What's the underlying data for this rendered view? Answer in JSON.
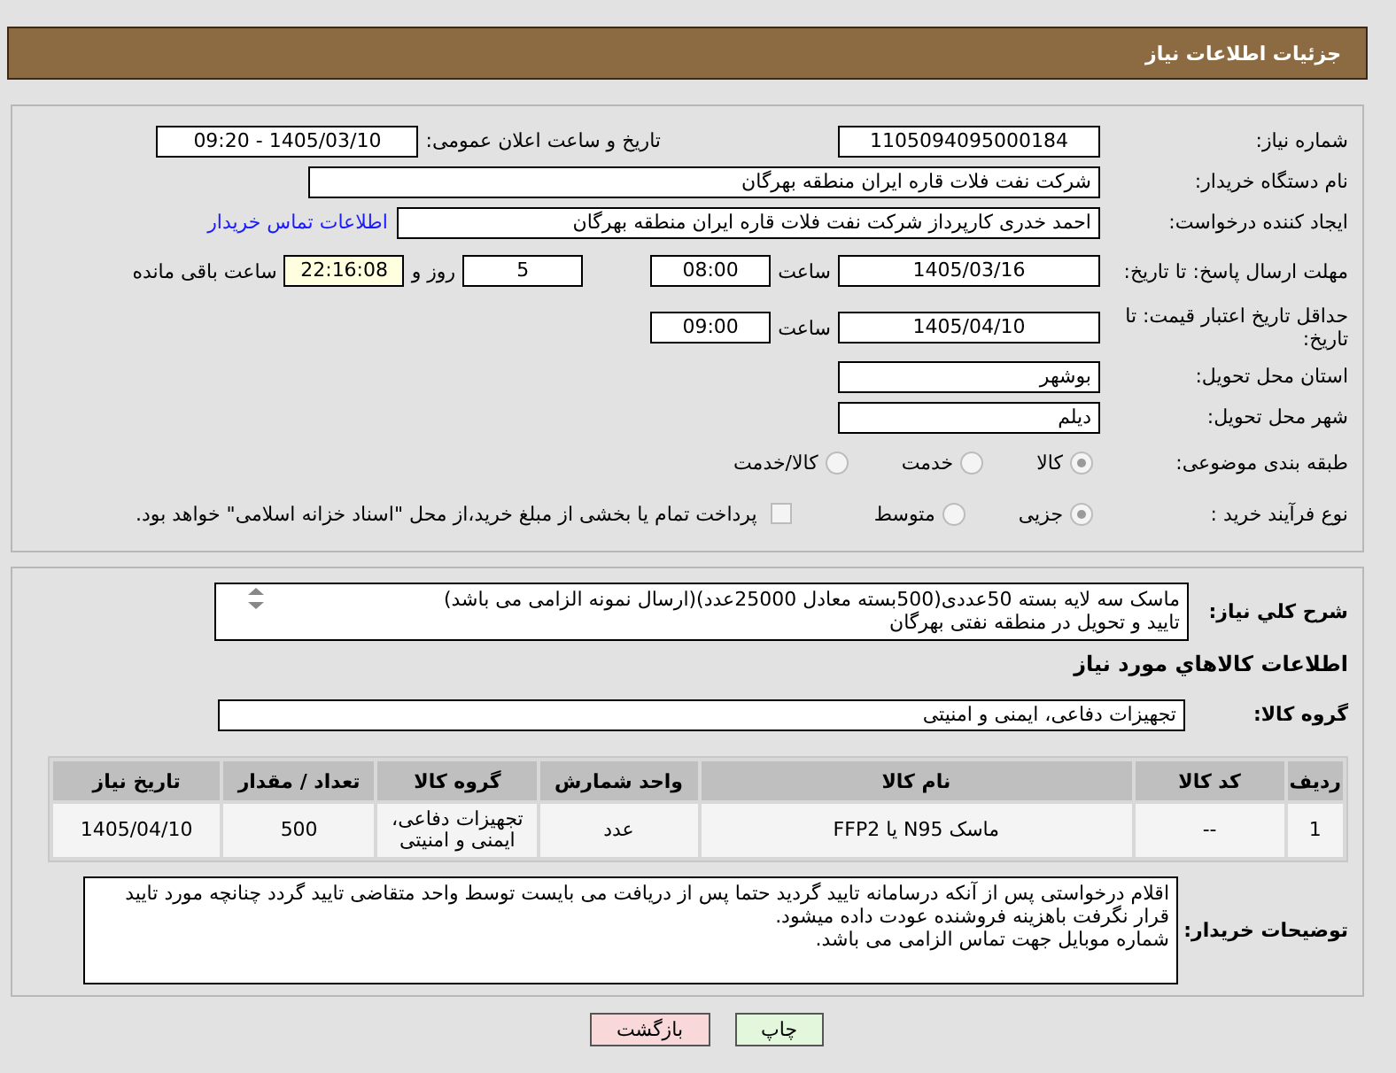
{
  "header": {
    "title": "جزئیات اطلاعات نیاز"
  },
  "need_number": {
    "label": "شماره نیاز:",
    "value": "1105094095000184"
  },
  "announce": {
    "label": "تاریخ و ساعت اعلان عمومی:",
    "value": "1405/03/10 - 09:20"
  },
  "buyer_org": {
    "label": "نام دستگاه خریدار:",
    "value": "شرکت نفت فلات قاره ایران منطقه بهرگان"
  },
  "requester": {
    "label": "ایجاد کننده درخواست:",
    "value": "احمد خدری کارپرداز شرکت نفت فلات قاره ایران منطقه بهرگان",
    "link": "اطلاعات تماس خریدار"
  },
  "reply_deadline": {
    "label": "مهلت ارسال پاسخ: تا تاریخ:",
    "date": "1405/03/16",
    "time_label": "ساعت",
    "time": "08:00",
    "days": "5",
    "days_label": "روز و",
    "remaining": "22:16:08",
    "remaining_label": "ساعت باقی مانده"
  },
  "price_validity": {
    "label": "حداقل تاریخ اعتبار قیمت: تا تاریخ:",
    "date": "1405/04/10",
    "time_label": "ساعت",
    "time": "09:00"
  },
  "province": {
    "label": "استان محل تحویل:",
    "value": "بوشهر"
  },
  "city": {
    "label": "شهر محل تحویل:",
    "value": "دیلم"
  },
  "category": {
    "label": "طبقه بندی موضوعی:",
    "options": [
      {
        "label": "کالا",
        "selected": true
      },
      {
        "label": "خدمت",
        "selected": false
      },
      {
        "label": "کالا/خدمت",
        "selected": false
      }
    ]
  },
  "purchase_type": {
    "label": "نوع فرآیند خرید :",
    "options": [
      {
        "label": "جزیی",
        "selected": true
      },
      {
        "label": "متوسط",
        "selected": false
      }
    ],
    "treasury": {
      "label": "پرداخت تمام یا بخشی از مبلغ خرید،از محل \"اسناد خزانه اسلامی\" خواهد بود.",
      "checked": false
    }
  },
  "description": {
    "label": "شرح کلي نياز:",
    "text": "ماسک سه لایه بسته 50عددی(500بسته معادل 25000عدد)(ارسال نمونه الزامی می باشد)\nتایید و تحویل در منطقه نفتی بهرگان"
  },
  "goods_section": {
    "title": "اطلاعات کالاهاي مورد نياز"
  },
  "goods_group": {
    "label": "گروه کالا:",
    "value": "تجهیزات دفاعی، ایمنی و امنیتی"
  },
  "table": {
    "columns": [
      "ردیف",
      "کد کالا",
      "نام کالا",
      "واحد شمارش",
      "گروه کالا",
      "تعداد / مقدار",
      "تاریخ نیاز"
    ],
    "rows": [
      [
        "1",
        "--",
        "ماسک N95 یا FFP2",
        "عدد",
        "تجهیزات دفاعی، ایمنی و امنیتی",
        "500",
        "1405/04/10"
      ]
    ]
  },
  "buyer_notes": {
    "label": "توضیحات خریدار:",
    "text": "اقلام درخواستی پس از آنکه درسامانه تایید گردید حتما پس از دریافت می بایست توسط واحد متقاضی تایید گردد چنانچه مورد تایید قرار نگرفت باهزینه فروشنده عودت داده میشود.\nشماره موبایل جهت تماس الزامی می باشد."
  },
  "buttons": [
    {
      "label": "چاپ",
      "kind": "print"
    },
    {
      "label": "بازگشت",
      "kind": "back"
    }
  ]
}
